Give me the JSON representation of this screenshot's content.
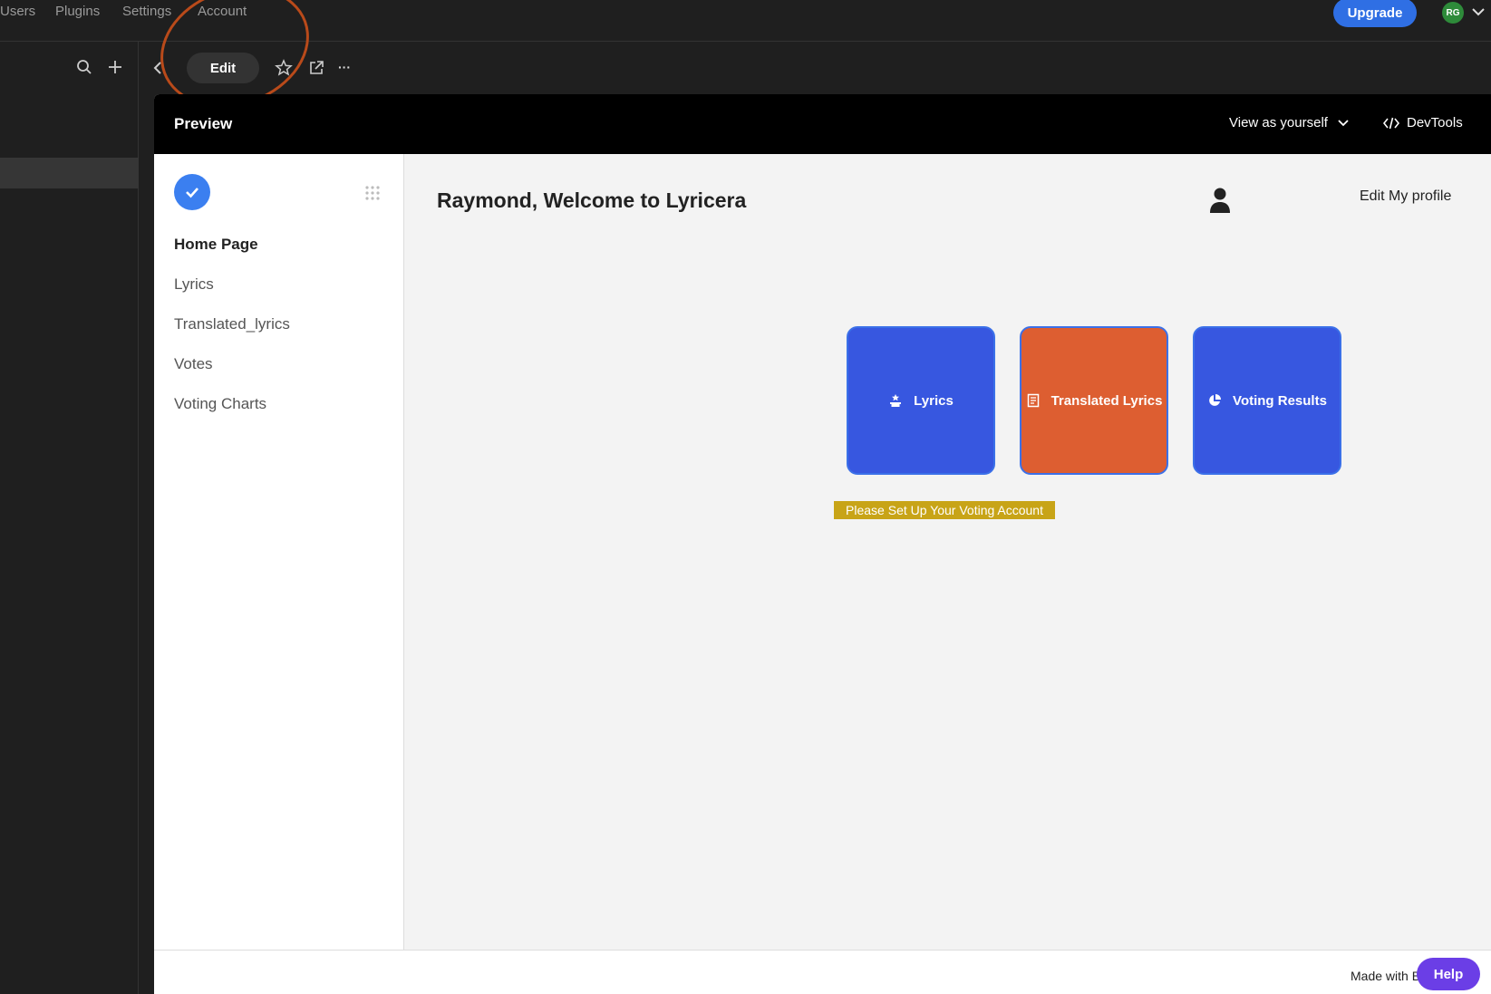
{
  "topnav": {
    "items": [
      "Users",
      "Plugins",
      "Settings",
      "Account"
    ],
    "upgrade_label": "Upgrade",
    "avatar_initials": "RG"
  },
  "toolbar": {
    "edit_label": "Edit",
    "more_label": "···"
  },
  "preview": {
    "title": "Preview",
    "view_as_label": "View as yourself",
    "devtools_label": "DevTools"
  },
  "app": {
    "nav": [
      {
        "label": "Home Page",
        "active": true
      },
      {
        "label": "Lyrics"
      },
      {
        "label": "Translated_lyrics"
      },
      {
        "label": "Votes"
      },
      {
        "label": "Voting Charts"
      }
    ],
    "welcome": "Raymond, Welcome to Lyricera",
    "edit_profile_label": "Edit My profile",
    "tiles": [
      {
        "label": "Lyrics",
        "icon": "pedestal-icon",
        "color": "#3757e0"
      },
      {
        "label": "Translated Lyrics",
        "icon": "document-list-icon",
        "color": "#dd5e31"
      },
      {
        "label": "Voting Results",
        "icon": "pie-chart-icon",
        "color": "#3757e0"
      }
    ],
    "banner": "Please Set Up Your Voting Account"
  },
  "footer": {
    "made_with": "Made with B",
    "help_label": "Help"
  }
}
